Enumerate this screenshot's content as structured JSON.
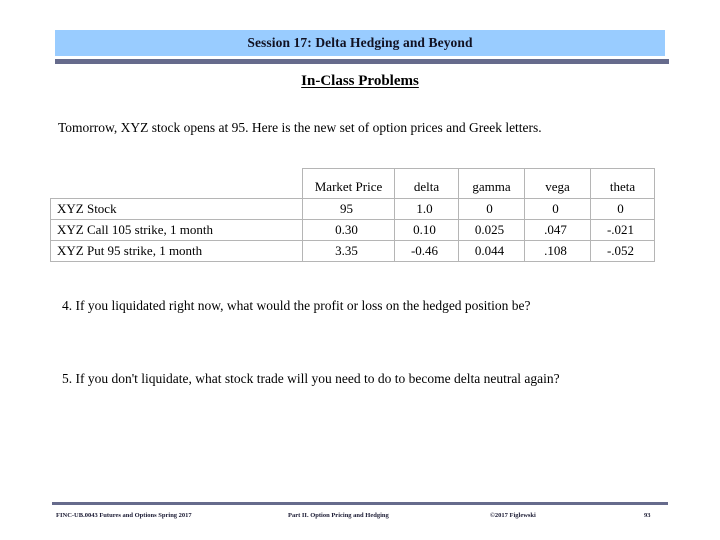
{
  "slide": {
    "title": "Session 17: Delta Hedging and Beyond",
    "subheading": "In-Class Problems ",
    "intro": "Tomorrow, XYZ stock opens at 95.  Here is the new set of option prices and Greek letters.",
    "title_banner_color": "#99ccff",
    "rule_color": "#666b8c"
  },
  "table": {
    "columns": [
      "",
      "Market Price",
      "delta",
      "gamma",
      "vega",
      "theta"
    ],
    "rows": [
      {
        "label": "XYZ Stock",
        "market_price": "95",
        "delta": "1.0",
        "gamma": "0",
        "vega": "0",
        "theta": "0"
      },
      {
        "label": "XYZ Call 105 strike, 1 month",
        "market_price": "0.30",
        "delta": "0.10",
        "gamma": "0.025",
        "vega": ".047",
        "theta": "-.021"
      },
      {
        "label": "XYZ Put  95 strike, 1 month",
        "market_price": "3.35",
        "delta": "-0.46",
        "gamma": "0.044",
        "vega": ".108",
        "theta": "-.052"
      }
    ]
  },
  "questions": [
    "4.  If you liquidated right now, what would the profit or loss on the hedged position be?",
    "5.  If you don't liquidate, what stock trade will you need to do to become delta neutral again?"
  ],
  "footer": {
    "left": "FINC-UB.0043  Futures and Options   Spring 2017",
    "center": "Part II. Option Pricing and Hedging",
    "right": "©2017 Figlewski",
    "page": "93"
  }
}
